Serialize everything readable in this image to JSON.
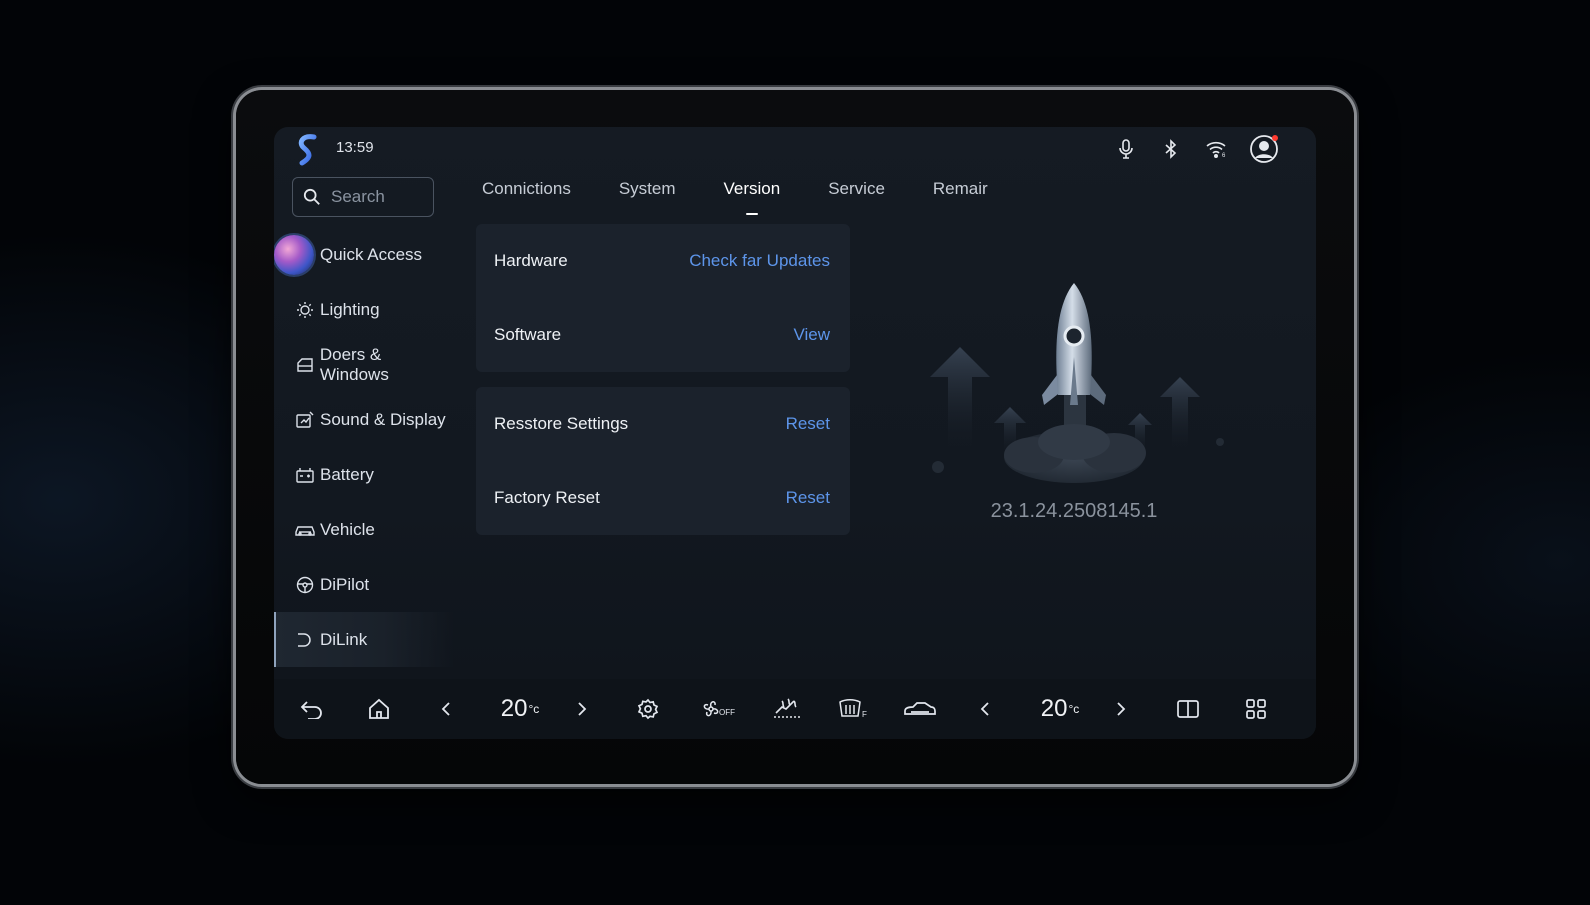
{
  "status_bar": {
    "time": "13:59",
    "icons": [
      "app-logo-icon",
      "microphone-icon",
      "bluetooth-icon",
      "wifi-icon",
      "user-avatar-icon"
    ]
  },
  "search": {
    "placeholder": "Search"
  },
  "sidebar": {
    "items": [
      {
        "label": "Quick Access",
        "icon": "quick-access-orb-icon"
      },
      {
        "label": "Lighting",
        "icon": "sun-icon"
      },
      {
        "label": "Doers & Windows",
        "icon": "door-icon"
      },
      {
        "label": "Sound & Display",
        "icon": "sound-display-icon"
      },
      {
        "label": "Battery",
        "icon": "battery-icon"
      },
      {
        "label": "Vehicle",
        "icon": "vehicle-icon"
      },
      {
        "label": "DiPilot",
        "icon": "steering-wheel-icon"
      },
      {
        "label": "DiLink",
        "icon": "dilink-icon"
      }
    ],
    "active": "DiLink"
  },
  "tabs": [
    {
      "label": "Connictions"
    },
    {
      "label": "System"
    },
    {
      "label": "Version"
    },
    {
      "label": "Service"
    },
    {
      "label": "Remair"
    }
  ],
  "active_tab": "Version",
  "cards": {
    "info": [
      {
        "label": "Hardware",
        "action": "Check far Updates"
      },
      {
        "label": "Software",
        "action": "View"
      }
    ],
    "reset": [
      {
        "label": "Resstore Settings",
        "action": "Reset"
      },
      {
        "label": "Factory Reset",
        "action": "Reset"
      }
    ]
  },
  "version_number": "23.1.24.2508145.1",
  "dock": {
    "left_temp": "20",
    "right_temp": "20",
    "temp_unit": "°c",
    "icons": [
      "back-icon",
      "home-icon",
      "temp-down-left-icon",
      "temp-up-left-icon",
      "settings-icon",
      "fan-off-icon",
      "seat-heat-icon",
      "rear-defrost-icon",
      "car-icon",
      "temp-down-right-icon",
      "temp-up-right-icon",
      "split-screen-icon",
      "app-grid-icon"
    ]
  },
  "colors": {
    "accent": "#5d95ea",
    "background": "#151b23",
    "card": "#1b222c"
  }
}
